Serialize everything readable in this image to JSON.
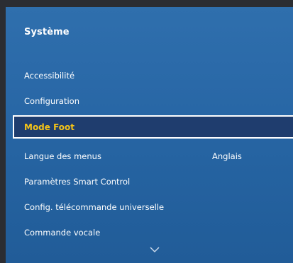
{
  "menu": {
    "title": "Système",
    "items": [
      {
        "label": "Accessibilité"
      },
      {
        "label": "Configuration"
      },
      {
        "label": "Mode Foot"
      },
      {
        "label": "Langue des menus",
        "value": "Anglais"
      },
      {
        "label": "Paramètres Smart Control"
      },
      {
        "label": "Config. télécommande universelle"
      },
      {
        "label": "Commande vocale"
      }
    ],
    "selected_index": 2,
    "more_icon": "chevron-down-icon"
  },
  "colors": {
    "panel": "#2a69a8",
    "highlight_text": "#f5c318",
    "highlight_bg": "#1f3d6e",
    "text": "#ffffff"
  }
}
